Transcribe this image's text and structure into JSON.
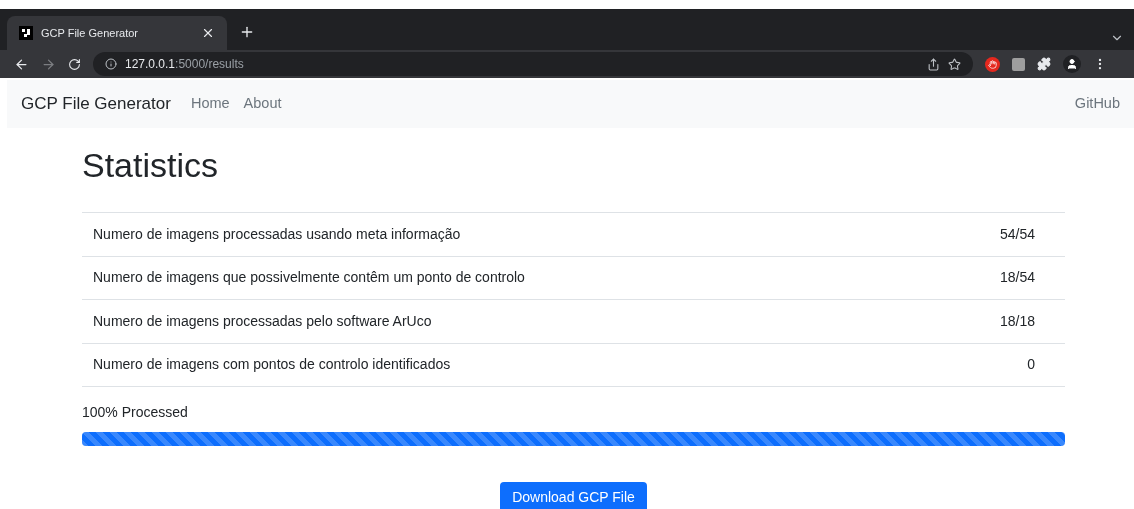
{
  "browser": {
    "tab": {
      "title": "GCP File Generator",
      "selected": true
    },
    "url": {
      "host": "127.0.0.1",
      "path": ":5000/results"
    }
  },
  "navbar": {
    "brand": "GCP File Generator",
    "links": [
      "Home",
      "About"
    ],
    "right_link": "GitHub"
  },
  "heading": "Statistics",
  "stats": [
    {
      "label": "Numero de imagens processadas usando meta informação",
      "value": "54/54"
    },
    {
      "label": "Numero de imagens que possivelmente contêm um ponto de controlo",
      "value": "18/54"
    },
    {
      "label": "Numero de imagens processadas pelo software ArUco",
      "value": "18/18"
    },
    {
      "label": "Numero de imagens com pontos de controlo identificados",
      "value": "0"
    }
  ],
  "progress": {
    "label": "100% Processed",
    "level": 1
  },
  "download_button": "Download GCP File"
}
